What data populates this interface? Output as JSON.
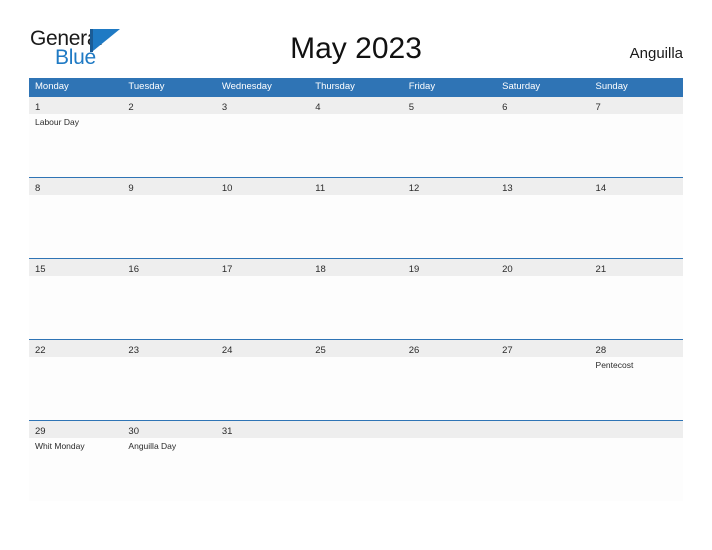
{
  "logo": {
    "line1": "General",
    "line2": "Blue",
    "mark_icon": "pennant-flag-icon",
    "brand_color": "#1f7ac4"
  },
  "header": {
    "title": "May 2023",
    "region": "Anguilla"
  },
  "calendar": {
    "accent_color": "#2f74b5",
    "date_band_color": "#eeeeee",
    "weekdays": [
      "Monday",
      "Tuesday",
      "Wednesday",
      "Thursday",
      "Friday",
      "Saturday",
      "Sunday"
    ],
    "weeks": [
      {
        "days": [
          {
            "date": "1",
            "event": "Labour Day"
          },
          {
            "date": "2",
            "event": ""
          },
          {
            "date": "3",
            "event": ""
          },
          {
            "date": "4",
            "event": ""
          },
          {
            "date": "5",
            "event": ""
          },
          {
            "date": "6",
            "event": ""
          },
          {
            "date": "7",
            "event": ""
          }
        ]
      },
      {
        "days": [
          {
            "date": "8",
            "event": ""
          },
          {
            "date": "9",
            "event": ""
          },
          {
            "date": "10",
            "event": ""
          },
          {
            "date": "11",
            "event": ""
          },
          {
            "date": "12",
            "event": ""
          },
          {
            "date": "13",
            "event": ""
          },
          {
            "date": "14",
            "event": ""
          }
        ]
      },
      {
        "days": [
          {
            "date": "15",
            "event": ""
          },
          {
            "date": "16",
            "event": ""
          },
          {
            "date": "17",
            "event": ""
          },
          {
            "date": "18",
            "event": ""
          },
          {
            "date": "19",
            "event": ""
          },
          {
            "date": "20",
            "event": ""
          },
          {
            "date": "21",
            "event": ""
          }
        ]
      },
      {
        "days": [
          {
            "date": "22",
            "event": ""
          },
          {
            "date": "23",
            "event": ""
          },
          {
            "date": "24",
            "event": ""
          },
          {
            "date": "25",
            "event": ""
          },
          {
            "date": "26",
            "event": ""
          },
          {
            "date": "27",
            "event": ""
          },
          {
            "date": "28",
            "event": "Pentecost"
          }
        ]
      },
      {
        "days": [
          {
            "date": "29",
            "event": "Whit Monday"
          },
          {
            "date": "30",
            "event": "Anguilla Day"
          },
          {
            "date": "31",
            "event": ""
          },
          {
            "date": "",
            "event": ""
          },
          {
            "date": "",
            "event": ""
          },
          {
            "date": "",
            "event": ""
          },
          {
            "date": "",
            "event": ""
          }
        ]
      }
    ]
  }
}
